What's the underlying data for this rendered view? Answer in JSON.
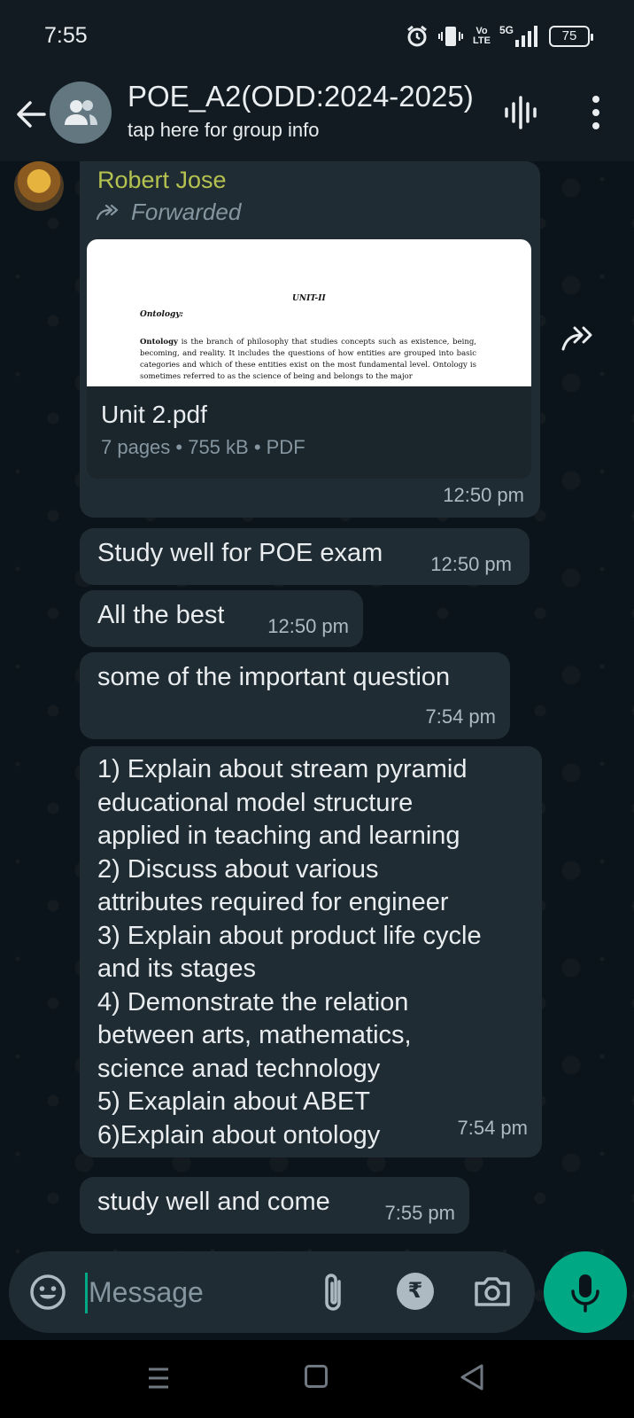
{
  "status_bar": {
    "time": "7:55",
    "volte": "Vo\nLTE",
    "network": "5G",
    "battery": "75"
  },
  "header": {
    "title": "POE_A2(ODD:2024-2025)",
    "subtitle": "tap here for group info"
  },
  "messages": {
    "document": {
      "sender": "Robert Jose",
      "sender_color": "#b5c24f",
      "forwarded_label": "Forwarded",
      "preview": {
        "unit": "UNIT-II",
        "heading": "Ontology:",
        "body_bold": "Ontology",
        "body": " is the branch of philosophy that studies concepts such as existence, being, becoming, and reality. It includes the questions of how entities are grouped into basic categories and which of these entities exist on the most fundamental level. Ontology is sometimes referred to as the science of being and belongs to the major"
      },
      "file_name": "Unit 2.pdf",
      "file_meta": "7 pages • 755 kB • PDF",
      "time": "12:50 pm"
    },
    "items": [
      {
        "text": "Study well for POE exam",
        "time": "12:50 pm"
      },
      {
        "text": "All the best",
        "time": "12:50 pm"
      },
      {
        "text": "some of the important question",
        "time": "7:54 pm"
      },
      {
        "text": "1) Explain about stream pyramid\neducational model structure\napplied in teaching and learning\n2) Discuss about various\nattributes required for engineer\n3) Explain about product life cycle\nand its stages\n4) Demonstrate the relation\nbetween arts, mathematics,\nscience anad technology\n5) Exaplain about ABET\n6)Explain about ontology",
        "time": "7:54 pm"
      },
      {
        "text": "study well and come",
        "time": "7:55 pm"
      }
    ]
  },
  "input": {
    "placeholder": "Message",
    "rupee_symbol": "₹"
  },
  "colors": {
    "accent": "#00a884",
    "bubble": "#202c33",
    "background": "#0b141a"
  }
}
